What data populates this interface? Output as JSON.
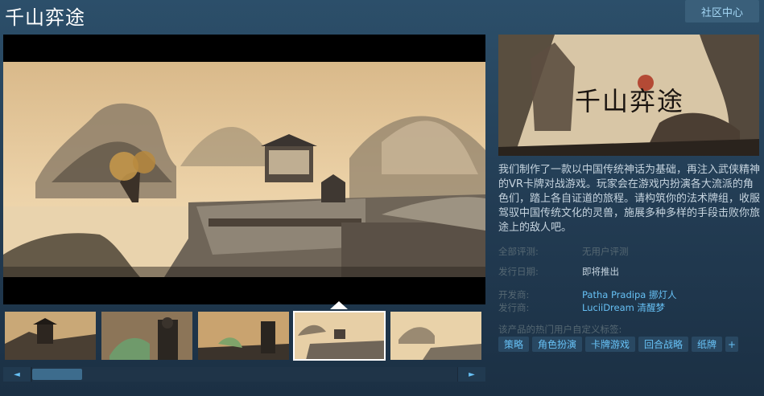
{
  "header": {
    "title": "千山弈途",
    "community_button": "社区中心"
  },
  "capsule": {
    "logo_text": "千山弈途"
  },
  "description": "我们制作了一款以中国传统神话为基础，再注入武侠精神的VR卡牌对战游戏。玩家会在游戏内扮演各大流派的角色们，踏上各自证道的旅程。请构筑你的法术牌组，收服驾驭中国传统文化的灵兽，施展多种多样的手段击败你旅途上的敌人吧。",
  "reviews": {
    "label": "全部评测:",
    "value": "无用户评测"
  },
  "release": {
    "label": "发行日期:",
    "value": "即将推出"
  },
  "developer": {
    "label": "开发商:",
    "value": "Patha Pradipa 挪灯人"
  },
  "publisher": {
    "label": "发行商:",
    "value": "LuciiDream 清醒梦"
  },
  "tags_label": "该产品的热门用户自定义标签:",
  "tags": [
    "策略",
    "角色扮演",
    "卡牌游戏",
    "回合战略",
    "纸牌",
    "+"
  ],
  "scroll": {
    "left_icon": "◄",
    "right_icon": "►"
  },
  "colors": {
    "link": "#66c0f4",
    "tag_bg": "#294862",
    "accent_btn": "#3a5f7a"
  }
}
